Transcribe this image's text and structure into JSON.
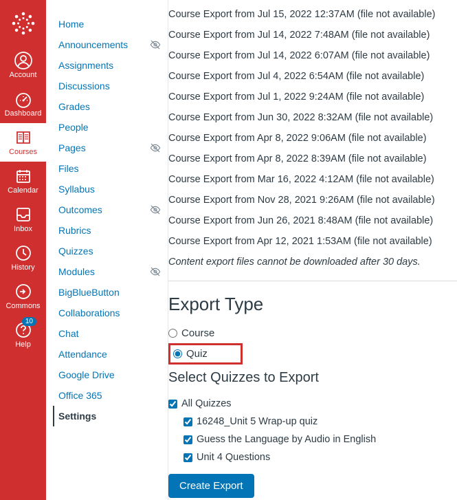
{
  "globalNav": {
    "items": [
      {
        "id": "account",
        "label": "Account"
      },
      {
        "id": "dashboard",
        "label": "Dashboard"
      },
      {
        "id": "courses",
        "label": "Courses"
      },
      {
        "id": "calendar",
        "label": "Calendar"
      },
      {
        "id": "inbox",
        "label": "Inbox"
      },
      {
        "id": "history",
        "label": "History"
      },
      {
        "id": "commons",
        "label": "Commons"
      },
      {
        "id": "help",
        "label": "Help",
        "badge": "10"
      }
    ],
    "activeId": "courses"
  },
  "courseNav": {
    "items": [
      {
        "label": "Home",
        "hidden": false
      },
      {
        "label": "Announcements",
        "hidden": true
      },
      {
        "label": "Assignments",
        "hidden": false
      },
      {
        "label": "Discussions",
        "hidden": false
      },
      {
        "label": "Grades",
        "hidden": false
      },
      {
        "label": "People",
        "hidden": false
      },
      {
        "label": "Pages",
        "hidden": true
      },
      {
        "label": "Files",
        "hidden": false
      },
      {
        "label": "Syllabus",
        "hidden": false
      },
      {
        "label": "Outcomes",
        "hidden": true
      },
      {
        "label": "Rubrics",
        "hidden": false
      },
      {
        "label": "Quizzes",
        "hidden": false
      },
      {
        "label": "Modules",
        "hidden": true
      },
      {
        "label": "BigBlueButton",
        "hidden": false
      },
      {
        "label": "Collaborations",
        "hidden": false
      },
      {
        "label": "Chat",
        "hidden": false
      },
      {
        "label": "Attendance",
        "hidden": false
      },
      {
        "label": "Google Drive",
        "hidden": false
      },
      {
        "label": "Office 365",
        "hidden": false
      },
      {
        "label": "Settings",
        "hidden": false,
        "active": true
      }
    ]
  },
  "exports": [
    "Course Export from Jul 15, 2022 12:37AM (file not available)",
    "Course Export from Jul 14, 2022 7:48AM (file not available)",
    "Course Export from Jul 14, 2022 6:07AM (file not available)",
    "Course Export from Jul 4, 2022 6:54AM (file not available)",
    "Course Export from Jul 1, 2022 9:24AM (file not available)",
    "Course Export from Jun 30, 2022 8:32AM (file not available)",
    "Course Export from Apr 8, 2022 9:06AM (file not available)",
    "Course Export from Apr 8, 2022 8:39AM (file not available)",
    "Course Export from Mar 16, 2022 4:12AM (file not available)",
    "Course Export from Nov 28, 2021 9:26AM (file not available)",
    "Course Export from Jun 26, 2021 8:48AM (file not available)",
    "Course Export from Apr 12, 2021 1:53AM (file not available)"
  ],
  "exportNote": "Content export files cannot be downloaded after 30 days.",
  "exportType": {
    "heading": "Export Type",
    "options": {
      "course": "Course",
      "quiz": "Quiz"
    },
    "selected": "quiz"
  },
  "quizSelect": {
    "heading": "Select Quizzes to Export",
    "allLabel": "All Quizzes",
    "quizzes": [
      "16248_Unit 5 Wrap-up quiz",
      "Guess the Language by Audio in English",
      "Unit 4 Questions"
    ]
  },
  "buttonLabel": "Create Export"
}
